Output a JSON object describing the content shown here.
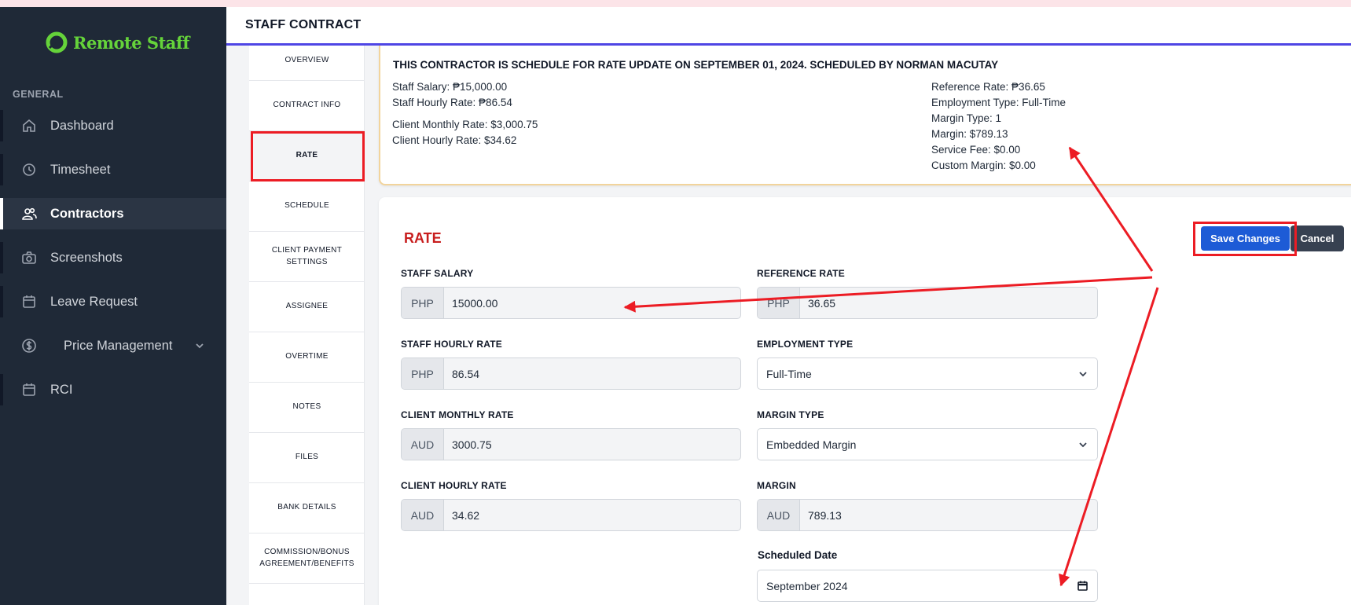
{
  "app": {
    "logo_text": "Remote Staff"
  },
  "sidebar": {
    "section_label": "GENERAL",
    "items": [
      {
        "label": "Dashboard",
        "icon": "home-icon"
      },
      {
        "label": "Timesheet",
        "icon": "clock-icon"
      },
      {
        "label": "Contractors",
        "icon": "users-icon",
        "active": true
      },
      {
        "label": "Screenshots",
        "icon": "camera-icon"
      },
      {
        "label": "Leave Request",
        "icon": "calendar-icon"
      },
      {
        "label": "Price Management",
        "icon": "dollar-icon",
        "expandable": true
      },
      {
        "label": "RCI",
        "icon": "calendar-icon"
      }
    ]
  },
  "header": {
    "title": "STAFF CONTRACT"
  },
  "tabs": [
    {
      "label": "OVERVIEW"
    },
    {
      "label": "CONTRACT INFO"
    },
    {
      "label": "RATE",
      "active": true
    },
    {
      "label": "SCHEDULE"
    },
    {
      "label": "CLIENT PAYMENT SETTINGS"
    },
    {
      "label": "ASSIGNEE"
    },
    {
      "label": "OVERTIME"
    },
    {
      "label": "NOTES"
    },
    {
      "label": "FILES"
    },
    {
      "label": "BANK DETAILS"
    },
    {
      "label": "COMMISSION/BONUS AGREEMENT/BENEFITS"
    }
  ],
  "notice": {
    "title": "THIS CONTRACTOR IS SCHEDULE FOR RATE UPDATE ON SEPTEMBER 01, 2024. SCHEDULED BY NORMAN MACUTAY",
    "left": [
      "Staff Salary: ₱15,000.00",
      "Staff Hourly Rate: ₱86.54",
      "Client Monthly Rate: $3,000.75",
      "Client Hourly Rate: $34.62"
    ],
    "right": [
      "Reference Rate: ₱36.65",
      "Employment Type: Full-Time",
      "Margin Type: 1",
      "Margin: $789.13",
      "Service Fee: $0.00",
      "Custom Margin: $0.00"
    ]
  },
  "rate_form": {
    "title": "RATE",
    "save_label": "Save Changes",
    "cancel_label": "Cancel",
    "staff_salary": {
      "label": "STAFF SALARY",
      "currency": "PHP",
      "value": "15000.00"
    },
    "staff_hourly_rate": {
      "label": "STAFF HOURLY RATE",
      "currency": "PHP",
      "value": "86.54"
    },
    "client_monthly_rate": {
      "label": "CLIENT MONTHLY RATE",
      "currency": "AUD",
      "value": "3000.75"
    },
    "client_hourly_rate": {
      "label": "CLIENT HOURLY RATE",
      "currency": "AUD",
      "value": "34.62"
    },
    "reference_rate": {
      "label": "REFERENCE RATE",
      "currency": "PHP",
      "value": "36.65"
    },
    "employment_type": {
      "label": "EMPLOYMENT TYPE",
      "value": "Full-Time"
    },
    "margin_type": {
      "label": "MARGIN TYPE",
      "value": "Embedded Margin"
    },
    "margin": {
      "label": "MARGIN",
      "currency": "AUD",
      "value": "789.13"
    },
    "scheduled_date": {
      "label": "Scheduled Date",
      "value": "September 2024"
    }
  },
  "colors": {
    "sidebar_bg": "#1f2937",
    "brand_green": "#65d33a",
    "header_accent": "#4f46e5",
    "rate_title": "#c81e1e",
    "save_button": "#1d5bd6",
    "annotation_red": "#ec1c24",
    "notice_border": "#f2d49c"
  }
}
